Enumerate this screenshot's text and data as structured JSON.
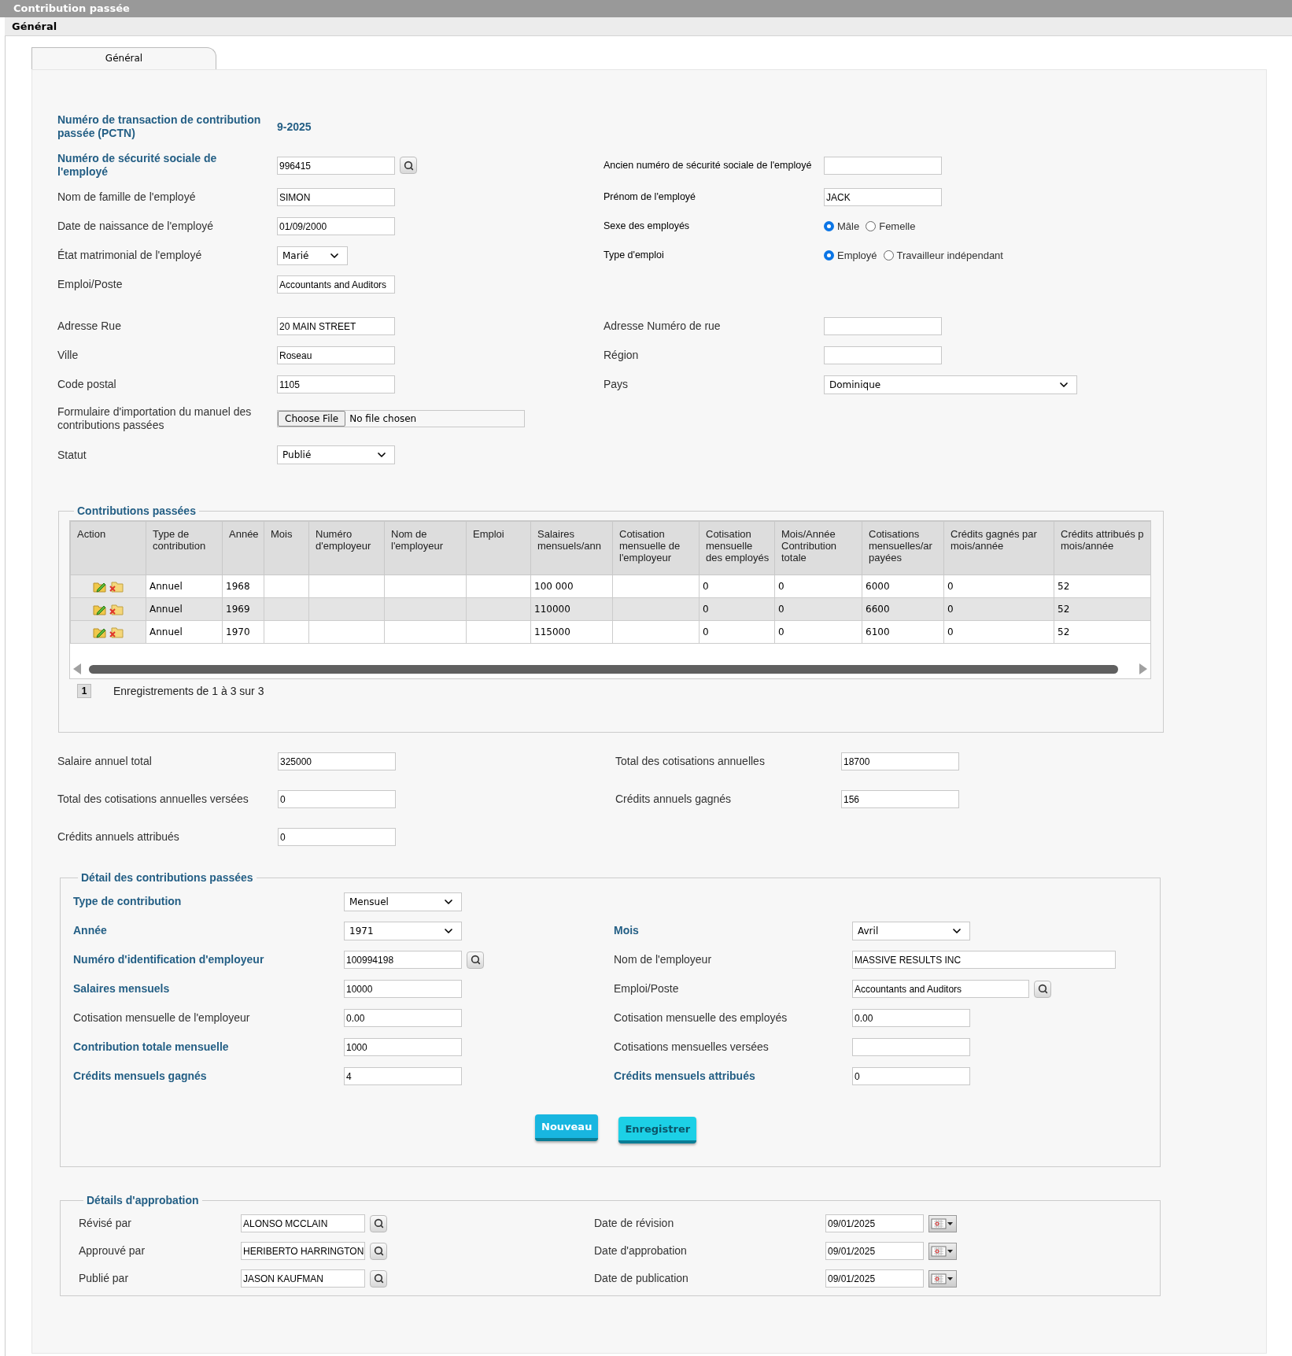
{
  "header": {
    "title": "Contribution passée",
    "subtitle": "Général"
  },
  "tabs": [
    {
      "label": "Général",
      "selected": true
    }
  ],
  "general": {
    "groups": [
      [
        {
          "left": {
            "label": "Numéro de transaction de contribution passée (PCTN)",
            "required": true,
            "kind": "static",
            "value": "9-2025"
          }
        },
        {
          "left": {
            "label": "Numéro de sécurité sociale de l'employé",
            "required": true,
            "kind": "lookup",
            "value": "996415"
          },
          "right": {
            "label": "Ancien numéro de sécurité sociale de l'employé",
            "kind": "text",
            "compact": true
          }
        },
        {
          "left": {
            "label": "Nom de famille de l'employé",
            "kind": "text",
            "value": "SIMON"
          },
          "right": {
            "label": "Prénom de l'employé",
            "kind": "text",
            "value": "JACK",
            "compact": true
          }
        },
        {
          "left": {
            "label": "Date de naissance de l'employé",
            "kind": "text",
            "value": "01/09/2000"
          },
          "right": {
            "label": "Sexe des employés",
            "kind": "radio",
            "compact": true,
            "options": [
              {
                "label": "Mâle",
                "selected": true
              },
              {
                "label": "Femelle",
                "selected": false
              }
            ]
          }
        },
        {
          "left": {
            "label": "État matrimonial de l'employé",
            "kind": "select",
            "narrow": true,
            "value": "Marié"
          },
          "right": {
            "label": "Type d'emploi",
            "kind": "radio",
            "compact": true,
            "options": [
              {
                "label": "Employé",
                "selected": true
              },
              {
                "label": "Travailleur indépendant",
                "selected": false
              }
            ]
          }
        },
        {
          "left": {
            "label": "Emploi/Poste",
            "kind": "text",
            "value": "Accountants and Auditors"
          }
        }
      ],
      [
        {
          "left": {
            "label": "Adresse Rue",
            "kind": "text",
            "value": "20 MAIN STREET"
          },
          "right": {
            "label": "Adresse Numéro de rue",
            "kind": "text"
          }
        },
        {
          "left": {
            "label": "Ville",
            "kind": "text",
            "value": "Roseau"
          },
          "right": {
            "label": "Région",
            "kind": "text"
          }
        },
        {
          "left": {
            "label": "Code postal",
            "kind": "text",
            "value": "1105"
          },
          "right": {
            "label": "Pays",
            "kind": "select",
            "wide": true,
            "value": "Dominique"
          }
        },
        {
          "left": {
            "label": "Formulaire d'importation du manuel des contributions passées",
            "kind": "file",
            "button": "Choose File",
            "value": "No file chosen"
          }
        },
        {
          "left": {
            "label": "Statut",
            "kind": "select",
            "value": "Publié"
          }
        }
      ]
    ]
  },
  "contributions": {
    "title": "Contributions passées",
    "columns": [
      "Action",
      "Type de\ncontribution",
      "Année",
      "Mois",
      "Numéro\nd'employeur",
      "Nom de\nl'employeur",
      "Emploi",
      "Salaires\nmensuels/ann",
      "Cotisation\nmensuelle de\nl'employeur",
      "Cotisation\nmensuelle\ndes employés",
      "Mois/Année\nContribution\ntotale",
      "Cotisations\nmensuelles/ar\npayées",
      "Crédits gagnés par\nmois/année",
      "Crédits attribués p\nmois/année"
    ],
    "rows": [
      {
        "cells": [
          "",
          "Annuel",
          "1968",
          null,
          null,
          null,
          null,
          "100 000",
          null,
          "0",
          "0",
          "6000",
          "0",
          "52"
        ]
      },
      {
        "cells": [
          "",
          "Annuel",
          "1969",
          null,
          null,
          null,
          null,
          "110000",
          null,
          "0",
          "0",
          "6600",
          "0",
          "52"
        ]
      },
      {
        "cells": [
          "",
          "Annuel",
          "1970",
          null,
          null,
          null,
          null,
          "115000",
          null,
          "0",
          "0",
          "6100",
          "0",
          "52"
        ]
      }
    ],
    "pages": [
      {
        "label": "1",
        "selected": true
      }
    ],
    "records": "Enregistrements de 1 à 3 sur 3"
  },
  "totals": {
    "rows": [
      {
        "left": {
          "label": "Salaire annuel total",
          "kind": "text",
          "value": "325000"
        },
        "right": {
          "label": "Total des cotisations annuelles",
          "kind": "text",
          "value": "18700"
        }
      },
      {
        "left": {
          "label": "Total des cotisations annuelles versées",
          "kind": "text",
          "value": "0"
        },
        "right": {
          "label": "Crédits annuels gagnés",
          "kind": "text",
          "value": "156"
        }
      },
      {
        "left": {
          "label": "Crédits annuels attribués",
          "kind": "text",
          "value": "0"
        }
      }
    ]
  },
  "detail": {
    "title": "Détail des contributions passées",
    "rows": [
      {
        "left": {
          "label": "Type de contribution",
          "required": true,
          "kind": "select",
          "value": "Mensuel"
        }
      },
      {
        "left": {
          "label": "Année",
          "required": true,
          "kind": "select",
          "value": "1971"
        },
        "right": {
          "label": "Mois",
          "required": true,
          "kind": "select",
          "value": "Avril"
        }
      },
      {
        "left": {
          "label": "Numéro d'identification d'employeur",
          "required": true,
          "kind": "lookup",
          "value": "100994198"
        },
        "right": {
          "label": "Nom de l'employeur",
          "kind": "text",
          "wide": true,
          "value": "MASSIVE RESULTS INC"
        }
      },
      {
        "left": {
          "label": "Salaires mensuels",
          "required": true,
          "kind": "text",
          "value": "10000"
        },
        "right": {
          "label": "Emploi/Poste",
          "kind": "lookup",
          "wide": true,
          "value": "Accountants and Auditors"
        }
      },
      {
        "left": {
          "label": "Cotisation mensuelle de l'employeur",
          "kind": "text",
          "value": "0.00"
        },
        "right": {
          "label": "Cotisation mensuelle des employés",
          "kind": "text",
          "value": "0.00"
        }
      },
      {
        "left": {
          "label": "Contribution totale mensuelle",
          "required": true,
          "kind": "text",
          "value": "1000"
        },
        "right": {
          "label": "Cotisations mensuelles versées",
          "kind": "text"
        }
      },
      {
        "left": {
          "label": "Crédits mensuels gagnés",
          "required": true,
          "kind": "text",
          "value": "4"
        },
        "right": {
          "label": "Crédits mensuels attribués",
          "required": true,
          "kind": "text",
          "value": "0"
        }
      }
    ],
    "buttons": [
      {
        "label": "Nouveau",
        "kind": "primary"
      },
      {
        "label": "Enregistrer",
        "kind": "secondary"
      }
    ]
  },
  "approval": {
    "title": "Détails d'approbation",
    "rows": [
      {
        "left": {
          "label": "Révisé par",
          "kind": "lookup",
          "value": "ALONSO MCCLAIN"
        },
        "right": {
          "label": "Date de révision",
          "kind": "date",
          "value": "09/01/2025"
        }
      },
      {
        "left": {
          "label": "Approuvé par",
          "kind": "lookup",
          "value": "HERIBERTO HARRINGTON"
        },
        "right": {
          "label": "Date d'approbation",
          "kind": "date",
          "value": "09/01/2025"
        }
      },
      {
        "left": {
          "label": "Publié par",
          "kind": "lookup",
          "value": "JASON KAUFMAN"
        },
        "right": {
          "label": "Date de publication",
          "kind": "date",
          "value": "09/01/2025"
        }
      }
    ]
  }
}
